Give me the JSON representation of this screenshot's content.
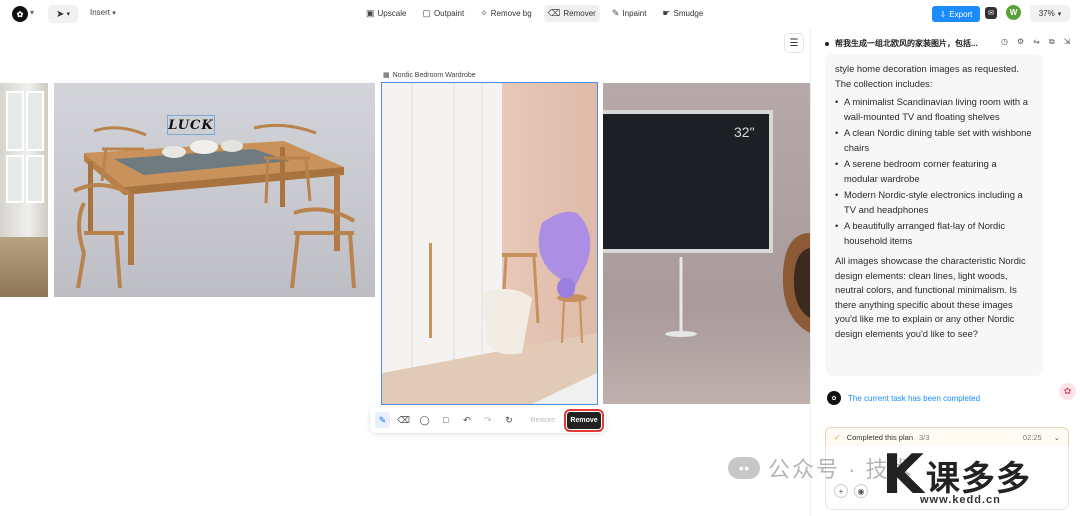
{
  "topbar": {
    "insert_label": "Insert",
    "tools": [
      {
        "label": "Upscale",
        "icon": "upscale-icon"
      },
      {
        "label": "Outpaint",
        "icon": "outpaint-icon"
      },
      {
        "label": "Remove bg",
        "icon": "remove-bg-icon"
      },
      {
        "label": "Remover",
        "icon": "remover-icon"
      },
      {
        "label": "Inpaint",
        "icon": "inpaint-icon"
      },
      {
        "label": "Smudge",
        "icon": "smudge-icon"
      }
    ],
    "export_label": "Export",
    "avatar_initial": "W",
    "zoom": "37%"
  },
  "canvas": {
    "wardrobe_label": "Nordic Bedroom Wardrobe",
    "luck_text": "LUCK",
    "tv_size": "32\""
  },
  "edit_bar": {
    "restore_label": "Restore",
    "remove_label": "Remove"
  },
  "panel": {
    "title": "帮我生成一组北欧风的家装图片，包括...",
    "intro": "style home decoration images as requested. The collection includes:",
    "items": [
      "A minimalist Scandinavian living room with a wall-mounted TV and floating shelves",
      "A clean Nordic dining table set with wishbone chairs",
      "A serene bedroom corner featuring a modular wardrobe",
      "Modern Nordic-style electronics including a TV and headphones",
      "A beautifully arranged flat-lay of Nordic household items"
    ],
    "summary": "All images showcase the characteristic Nordic design elements: clean lines, light woods, neutral colors, and functional minimalism. Is there anything specific about these images you'd like me to explain or any other Nordic design elements you'd like to see?",
    "task_status": "The current task has been completed",
    "plan_label": "Completed this plan",
    "plan_count": "3/3",
    "plan_time": "02:25"
  },
  "watermark": {
    "text": "公众号 · 技术",
    "brand": "课多多",
    "url": "www.kedd.cn"
  },
  "colors": {
    "accent": "#1a8cff",
    "remove_outline": "#e53935",
    "selection": "#4a90e2"
  }
}
